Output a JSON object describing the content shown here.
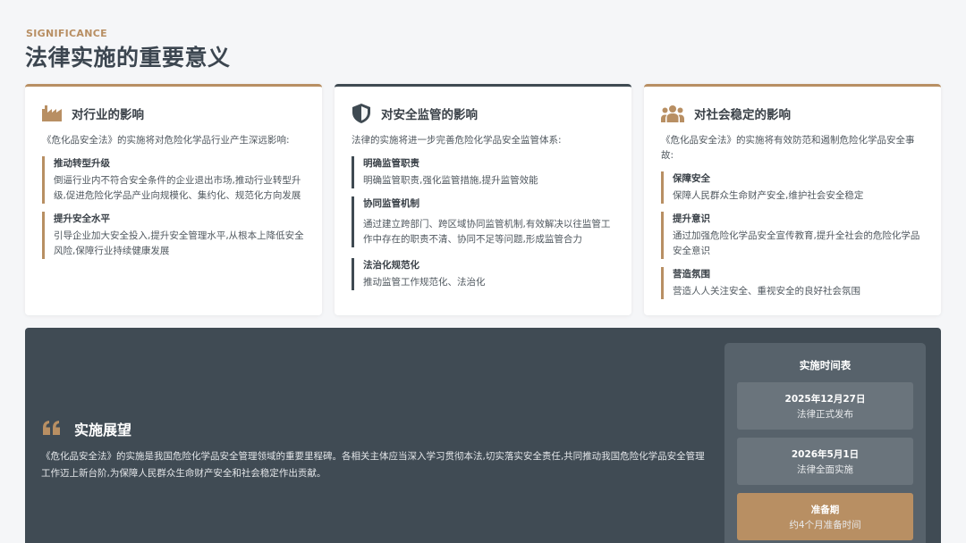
{
  "header": {
    "eyebrow": "SIGNIFICANCE",
    "title": "法律实施的重要意义"
  },
  "colors": {
    "accent": "#b88f63",
    "dark": "#404b54",
    "background": "#f5f6f8"
  },
  "cards": [
    {
      "icon": "factory-icon",
      "title": "对行业的影响",
      "intro": "《危化品安全法》的实施将对危险化学品行业产生深远影响:",
      "items": [
        {
          "title": "推动转型升级",
          "desc": "倒逼行业内不符合安全条件的企业退出市场,推动行业转型升级,促进危险化学品产业向规模化、集约化、规范化方向发展"
        },
        {
          "title": "提升安全水平",
          "desc": "引导企业加大安全投入,提升安全管理水平,从根本上降低安全风险,保障行业持续健康发展"
        }
      ]
    },
    {
      "icon": "shield-icon",
      "title": "对安全监管的影响",
      "intro": "法律的实施将进一步完善危险化学品安全监管体系:",
      "items": [
        {
          "title": "明确监管职责",
          "desc": "明确监管职责,强化监管措施,提升监管效能"
        },
        {
          "title": "协同监管机制",
          "desc": "通过建立跨部门、跨区域协同监管机制,有效解决以往监管工作中存在的职责不清、协同不足等问题,形成监管合力"
        },
        {
          "title": "法治化规范化",
          "desc": "推动监管工作规范化、法治化"
        }
      ]
    },
    {
      "icon": "people-group-icon",
      "title": "对社会稳定的影响",
      "intro": "《危化品安全法》的实施将有效防范和遏制危险化学品安全事故:",
      "items": [
        {
          "title": "保障安全",
          "desc": "保障人民群众生命财产安全,维护社会安全稳定"
        },
        {
          "title": "提升意识",
          "desc": "通过加强危险化学品安全宣传教育,提升全社会的危险化学品安全意识"
        },
        {
          "title": "营造氛围",
          "desc": "营造人人关注安全、重视安全的良好社会氛围"
        }
      ]
    }
  ],
  "outlook": {
    "icon": "quote-icon",
    "title": "实施展望",
    "text": "《危化品安全法》的实施是我国危险化学品安全管理领域的重要里程碑。各相关主体应当深入学习贯彻本法,切实落实安全责任,共同推动我国危险化学品安全管理工作迈上新台阶,为保障人民群众生命财产安全和社会稳定作出贡献。"
  },
  "timeline": {
    "title": "实施时间表",
    "items": [
      {
        "date": "2025年12月27日",
        "desc": "法律正式发布"
      },
      {
        "date": "2026年5月1日",
        "desc": "法律全面实施"
      },
      {
        "date": "准备期",
        "desc": "约4个月准备时间"
      }
    ]
  }
}
